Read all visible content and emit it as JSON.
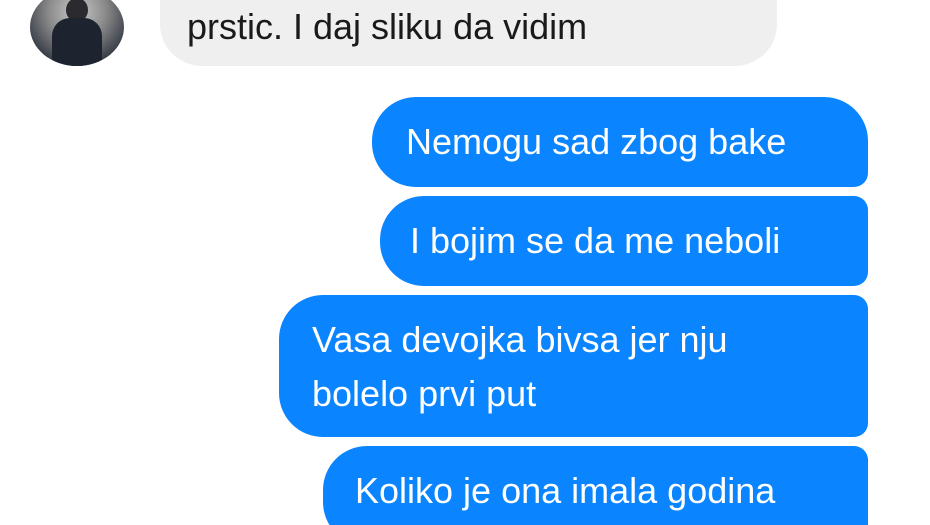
{
  "conversation": {
    "incoming": [
      {
        "text": "prstic. I daj sliku da vidim"
      }
    ],
    "outgoing": [
      {
        "text": "Nemogu sad zbog bake"
      },
      {
        "text": "I bojim se da me neboli"
      },
      {
        "lines": [
          "Vasa devojka bivsa jer nju",
          "bolelo prvi put"
        ]
      },
      {
        "text": "Koliko je ona imala godina"
      }
    ]
  },
  "colors": {
    "outgoing_bubble": "#0a84ff",
    "incoming_bubble": "#efefef",
    "outgoing_text": "#ffffff",
    "incoming_text": "#1a1a1a"
  },
  "icons": {
    "contact_avatar": "contact-avatar-photo"
  }
}
